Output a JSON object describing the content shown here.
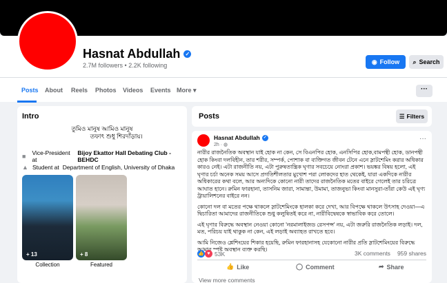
{
  "profile": {
    "name": "Hasnat Abdullah",
    "followers": "2.7M followers",
    "following": "2.2K following",
    "separator": "•",
    "follow_label": "Follow",
    "search_label": "Search"
  },
  "tabs": [
    {
      "label": "Posts"
    },
    {
      "label": "About"
    },
    {
      "label": "Reels"
    },
    {
      "label": "Photos"
    },
    {
      "label": "Videos"
    },
    {
      "label": "Events"
    },
    {
      "label": "More ▾"
    }
  ],
  "tabs_more_dots": "···",
  "intro": {
    "title": "Intro",
    "bio_line1": "তুমিও মানুষ আমিও মানুষ",
    "bio_line2": "তফাৎ শুধু শিরদাঁড়ায়। ⁠",
    "work_prefix": "Vice-President at ",
    "work_org": "Bijoy Ekattor Hall Debating Club - BEHDC",
    "edu_prefix": "Student at ",
    "edu_org": "Department of English, University of Dhaka",
    "thumb1_count": "+ 13",
    "thumb2_count": "+ 8",
    "thumb1_caption": "Collection",
    "thumb2_caption": "Featured"
  },
  "posts_header": {
    "title": "Posts",
    "filters_label": "Filters"
  },
  "post": {
    "author": "Hasnat Abdullah",
    "time": "2h · ",
    "menu": "···",
    "para1": "নারীর রাজনৈতিক অবস্থান যাই হোক না কেন, সে বিএনপির হোক, এনসিপির হোক,বামপন্থী হোক, ডানপন্থী হোক কিংবা দলবিহীন, তার শরীর, সম্পর্ক, পোশাক বা ব্যক্তিগত জীবন টেনে এনে স্লাটশেমিং করার অধিকার কারও নেই। এটা রাজনীতি নয়, এটা পুরুষতান্ত্রিক ঘৃণার সবচেয়ে নোংরা প্রকাশ। ভয়ঙ্কর বিষয় হলো, এই ঘৃণার চর্চা অনেক সময় আসে প্রগতিশীলতার মুখোশ পরা লোকদের হাত থেকেই, যারা একদিকে নারীর অধিকারের কথা বলে, আর অন্যদিকে কোনো নারী তাদের রাজনৈতিক মতের বাইরে গেলেই তার চরিত্রে আঘাত হানে। রুমিন ফারহানা, তাসনিম জারা, সামান্তা, উমামা, তাজনুভা কিংবা মানসুরা-তাঁরা কেউ এই ঘৃণ্য ট্রায়ালিশনের বাইরে নন।",
    "para2": "কোনো দল বা মতের পক্ষে থাকলে স্লাটশেমিংকে হালকা করে দেখা, আর বিপক্ষে থাকলে উৎসাহ দেওয়া—এ দ্বিচারিতা আমাদের রাজনীতিকে শুধু কলুষিতই করে না, নারীবিদ্বেষকে স্বাভাবিক করে তোলে।",
    "para3": "এই ঘৃণার বিরুদ্ধে অবস্থান নেওয়া কোনো 'নরমালাইজড রেসপন্স' নয়, এটা জরুরি রাজনৈতিক লড়াই। দল, মত, পরিচয় যাই থাকুক না কেন, এই লড়াই অব্যাহত রাখতে হবে।",
    "para4": "আমি নিজেও শ্লেশিংয়ের শিকার হয়েছি, রুমিন ফারহানাসহ যেকোনো নারীর প্রতি স্লাটশেমিংয়ের বিরুদ্ধে আমার স্পষ্ট অবস্থান ব্যক্ত করছি।",
    "reaction_count": "53K",
    "comments": "3K comments",
    "shares": "959 shares",
    "like_label": "Like",
    "comment_label": "Comment",
    "share_label": "Share",
    "view_more": "View more comments"
  },
  "colors": {
    "accent": "#1877f2",
    "avatar": "#ff0000",
    "cover": "#000000"
  },
  "icons": [
    "verified-badge-icon",
    "messenger-icon",
    "search-icon",
    "briefcase-icon",
    "graduation-cap-icon",
    "filter-icon",
    "like-icon",
    "comment-icon",
    "share-icon",
    "globe-icon"
  ]
}
